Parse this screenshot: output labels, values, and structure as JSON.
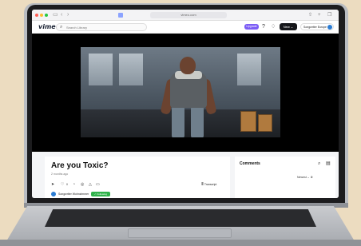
{
  "browser": {
    "traffic_lights": [
      "#ff5f57",
      "#febc2e",
      "#28c840"
    ],
    "nav_icons": [
      "sidebar-icon",
      "back-icon",
      "forward-icon"
    ],
    "url": "vimeo.com",
    "right_icons": [
      "share-icon",
      "plus-icon",
      "tabs-icon"
    ]
  },
  "topbar": {
    "logo": "vimeo",
    "search_placeholder": "Search Library",
    "upgrade_label": "Upgrade",
    "new_label": "New  ⌄",
    "account_label": "Songwriter Europe",
    "accent": "#7b5cf5"
  },
  "video": {
    "title": "Are you Toxic?",
    "date": "2 months ago",
    "like_count": "0",
    "transcript_label": "Transcript",
    "owner": "Songwriter Wohnzimmer",
    "following_label": "✓ Following",
    "following_color": "#2fb34a"
  },
  "comments": {
    "title": "Comments",
    "sort_label": "Newest  ⌄"
  }
}
